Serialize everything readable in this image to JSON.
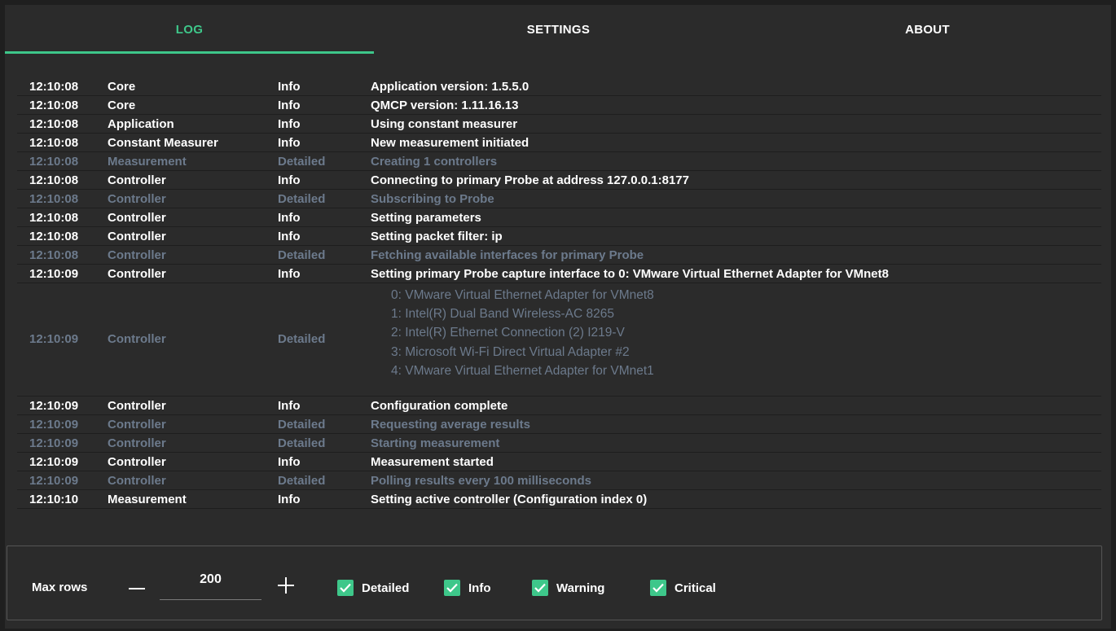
{
  "tabs": [
    {
      "label": "LOG",
      "active": true
    },
    {
      "label": "SETTINGS",
      "active": false
    },
    {
      "label": "ABOUT",
      "active": false
    }
  ],
  "log": [
    {
      "time": "12:10:08",
      "source": "Core",
      "level": "Info",
      "message": "Application version: 1.5.5.0"
    },
    {
      "time": "12:10:08",
      "source": "Core",
      "level": "Info",
      "message": "QMCP version: 1.11.16.13"
    },
    {
      "time": "12:10:08",
      "source": "Application",
      "level": "Info",
      "message": "Using constant measurer"
    },
    {
      "time": "12:10:08",
      "source": "Constant Measurer",
      "level": "Info",
      "message": "New measurement initiated"
    },
    {
      "time": "12:10:08",
      "source": "Measurement",
      "level": "Detailed",
      "message": "Creating 1 controllers"
    },
    {
      "time": "12:10:08",
      "source": "Controller",
      "level": "Info",
      "message": "Connecting to primary Probe at address 127.0.0.1:8177"
    },
    {
      "time": "12:10:08",
      "source": "Controller",
      "level": "Detailed",
      "message": "Subscribing to Probe"
    },
    {
      "time": "12:10:08",
      "source": "Controller",
      "level": "Info",
      "message": "Setting parameters"
    },
    {
      "time": "12:10:08",
      "source": "Controller",
      "level": "Info",
      "message": "Setting packet filter: ip"
    },
    {
      "time": "12:10:08",
      "source": "Controller",
      "level": "Detailed",
      "message": "Fetching available interfaces for primary Probe"
    },
    {
      "time": "12:10:09",
      "source": "Controller",
      "level": "Info",
      "message": "Setting primary Probe capture interface to 0: VMware Virtual Ethernet Adapter for VMnet8"
    },
    {
      "time": "12:10:09",
      "source": "Controller",
      "level": "Detailed",
      "lines": [
        "0: VMware Virtual Ethernet Adapter for VMnet8",
        "1: Intel(R) Dual Band Wireless-AC 8265",
        "2: Intel(R) Ethernet Connection (2) I219-V",
        "3: Microsoft Wi-Fi Direct Virtual Adapter #2",
        "4: VMware Virtual Ethernet Adapter for VMnet1"
      ]
    },
    {
      "time": "12:10:09",
      "source": "Controller",
      "level": "Info",
      "message": "Configuration complete"
    },
    {
      "time": "12:10:09",
      "source": "Controller",
      "level": "Detailed",
      "message": "Requesting average results"
    },
    {
      "time": "12:10:09",
      "source": "Controller",
      "level": "Detailed",
      "message": "Starting measurement"
    },
    {
      "time": "12:10:09",
      "source": "Controller",
      "level": "Info",
      "message": "Measurement started"
    },
    {
      "time": "12:10:09",
      "source": "Controller",
      "level": "Detailed",
      "message": "Polling results every 100 milliseconds"
    },
    {
      "time": "12:10:10",
      "source": "Measurement",
      "level": "Info",
      "message": "Setting active controller (Configuration index 0)"
    }
  ],
  "controls": {
    "max_rows_label": "Max rows",
    "max_rows_value": "200",
    "filters": [
      {
        "label": "Detailed",
        "checked": true
      },
      {
        "label": "Info",
        "checked": true
      },
      {
        "label": "Warning",
        "checked": true
      },
      {
        "label": "Critical",
        "checked": true
      }
    ]
  },
  "colors": {
    "accent": "#3ec78a",
    "background": "#2b2b2b",
    "detailed_text": "#6c7a8c",
    "info_text": "#ffffff"
  }
}
